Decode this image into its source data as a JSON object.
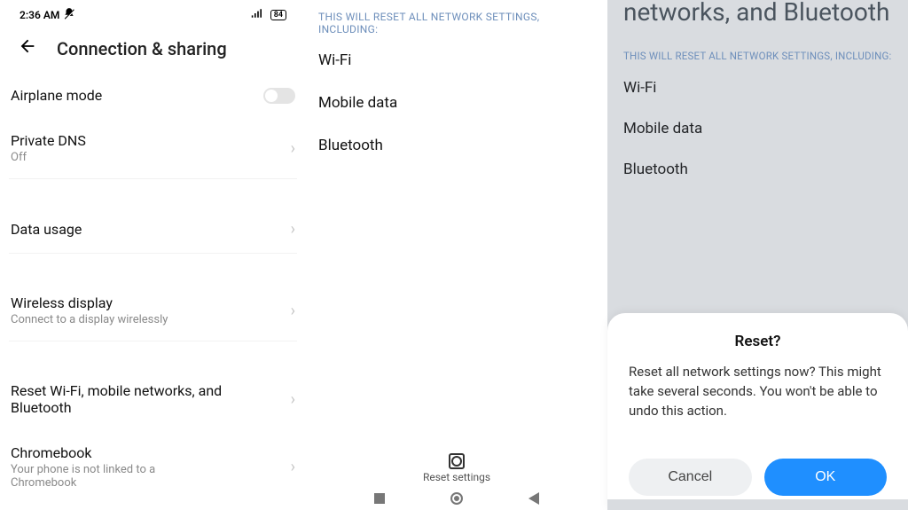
{
  "panel1": {
    "status": {
      "time": "2:36 AM",
      "battery": "84"
    },
    "title": "Connection & sharing",
    "airplane": {
      "title": "Airplane mode"
    },
    "dns": {
      "title": "Private DNS",
      "sub": "Off"
    },
    "datausage": {
      "title": "Data usage"
    },
    "wireless": {
      "title": "Wireless display",
      "sub": "Connect to a display wirelessly"
    },
    "reset": {
      "title": "Reset Wi-Fi, mobile networks, and Bluetooth"
    },
    "chromebook": {
      "title": "Chromebook",
      "sub": "Your phone is not linked to a Chromebook"
    }
  },
  "panel2": {
    "caption": "THIS WILL RESET ALL NETWORK SETTINGS, INCLUDING:",
    "items": {
      "wifi": "Wi-Fi",
      "mobile": "Mobile data",
      "bt": "Bluetooth"
    },
    "reset_btn": "Reset settings"
  },
  "panel3": {
    "head_partial": "networks, and Bluetooth",
    "caption": "THIS WILL RESET ALL NETWORK SETTINGS, INCLUDING:",
    "items": {
      "wifi": "Wi-Fi",
      "mobile": "Mobile data",
      "bt": "Bluetooth"
    },
    "dialog": {
      "title": "Reset?",
      "body": "Reset all network settings now? This might take several seconds. You won't be able to undo this action.",
      "cancel": "Cancel",
      "ok": "OK"
    }
  }
}
